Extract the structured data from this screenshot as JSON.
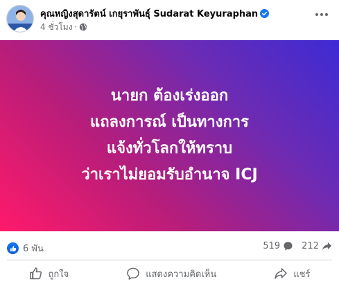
{
  "post": {
    "author": "คุณหญิงสุดารัตน์ เกยุราพันธุ์ Sudarat Keyuraphan",
    "time": "4 ชั่วโมง",
    "separator": "·"
  },
  "banner": {
    "lines": [
      "นายก ต้องเร่งออก",
      "แถลงการณ์ เป็นทางการ",
      "แจ้งทั่วโลกให้ทราบ",
      "ว่าเราไม่ยอมรับอำนาจ ICJ"
    ],
    "gradient_colors": [
      "#ff1a6a",
      "#b81d7a",
      "#6b2bb4",
      "#3d2bd4"
    ]
  },
  "stats": {
    "reactions": "6 พัน",
    "comments": "519",
    "shares": "212"
  },
  "actions": {
    "like": "ถูกใจ",
    "comment": "แสดงความคิดเห็น",
    "share": "แชร์"
  },
  "colors": {
    "accent": "#1877f2",
    "secondary_text": "#65676b"
  }
}
